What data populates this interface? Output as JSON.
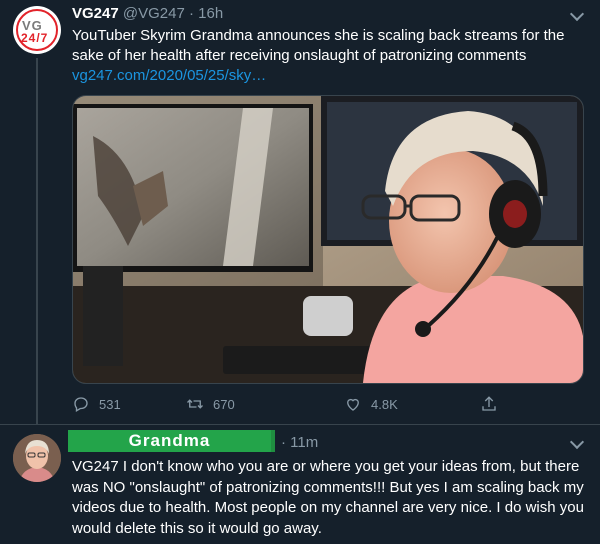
{
  "tweet": {
    "author_name": "VG247",
    "handle": "@VG247",
    "separator": "·",
    "time": "16h",
    "avatar_text_top": "VG",
    "avatar_text_bottom": "24/7",
    "text": "YouTuber Skyrim Grandma announces she is scaling back streams for the sake of her health after receiving onslaught of patronizing comments",
    "link": "vg247.com/2020/05/25/sky…",
    "media_icon": "photo-of-grandma-gaming-with-headset",
    "actions": {
      "reply_count": "531",
      "retweet_count": "670",
      "like_count": "4.8K"
    }
  },
  "reply": {
    "author_name": "Grandma",
    "time": "· 11m",
    "text": "VG247  I don't know who you are or where you get your ideas from,  but there was NO  \"onslaught\" of patronizing comments!!!  But yes I am scaling back my videos due to health.  Most people on my channel are very nice.  I do wish you would delete this so it would go away."
  },
  "colors": {
    "background": "#15202b",
    "muted": "#8899a6",
    "link": "#1b95e0",
    "name_highlight": "#23a44a"
  }
}
